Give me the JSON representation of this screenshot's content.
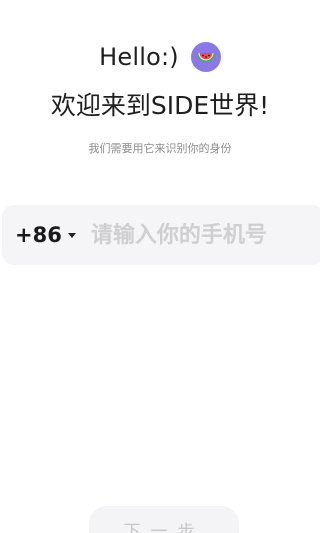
{
  "header": {
    "hello": "Hello:)",
    "emoji": "watermelon-icon",
    "welcome": "欢迎来到SIDE世界!",
    "subtitle": "我们需要用它来识别你的身份"
  },
  "phone": {
    "country_code": "+86",
    "value": "",
    "placeholder": "请输入你的手机号"
  },
  "actions": {
    "next_label": "下一步"
  },
  "colors": {
    "emoji_bg": "#8a78e6",
    "input_bg": "#f5f5f7",
    "placeholder": "#cfcfd3",
    "button_bg": "#f4f4f6"
  }
}
